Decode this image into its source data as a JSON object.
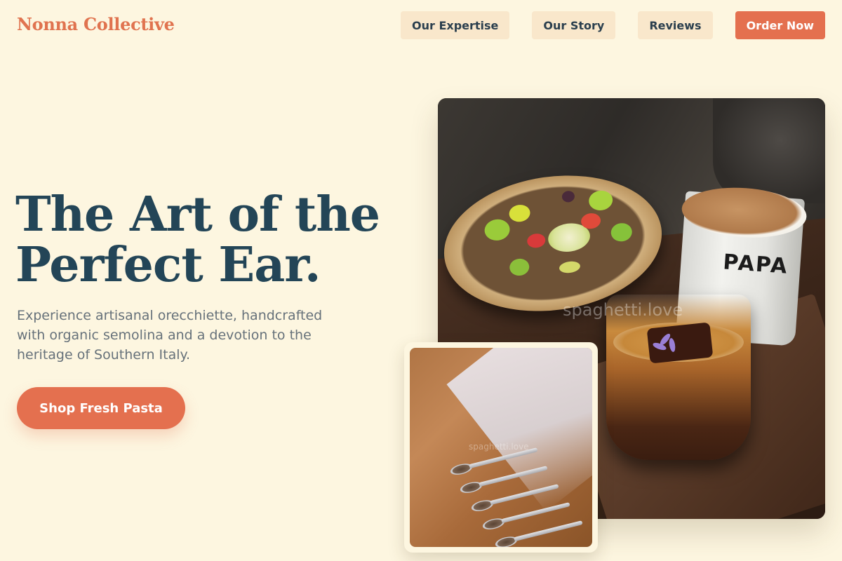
{
  "header": {
    "brand": "Nonna Collective",
    "nav": [
      {
        "label": "Our Expertise"
      },
      {
        "label": "Our Story"
      },
      {
        "label": "Reviews"
      }
    ],
    "cta_label": "Order Now"
  },
  "hero": {
    "title_line1": "The Art of the",
    "title_line2": "Perfect Ear.",
    "description": "Experience artisanal orecchiette, handcrafted with organic semolina and a devotion to the heritage of Southern Italy.",
    "button_label": "Shop Fresh Pasta"
  },
  "images": {
    "main": {
      "cup_text": "PAPA",
      "watermark": "spaghetti.love"
    },
    "inset": {
      "watermark": "spaghetti.love"
    }
  },
  "colors": {
    "background": "#fdf6e0",
    "accent": "#e4704f",
    "heading": "#234557",
    "nav_bg": "#f9e7cb"
  }
}
